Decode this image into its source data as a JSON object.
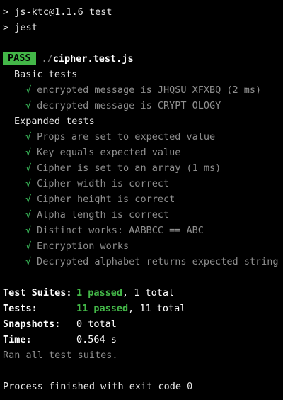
{
  "prompt": {
    "symbol": ">",
    "commands": [
      "js-ktc@1.1.6 test",
      "jest"
    ]
  },
  "result": {
    "badge": "PASS",
    "path_dir": "./",
    "path_file": "cipher.test.js"
  },
  "suites": [
    {
      "name": "Basic tests",
      "tests": [
        "encrypted message is JHQSU XFXBQ (2 ms)",
        "decrypted message is CRYPT OLOGY"
      ]
    },
    {
      "name": "Expanded tests",
      "tests": [
        "Props are set to expected value",
        "Key equals expected value",
        "Cipher is set to an array (1 ms)",
        "Cipher width is correct",
        "Cipher height is correct",
        "Alpha length is correct",
        "Distinct works: AABBCC == ABC",
        "Encryption works",
        "Decrypted alphabet returns expected string"
      ]
    }
  ],
  "check_mark": "√",
  "summary": {
    "suites_label": "Test Suites:",
    "suites_passed": "1 passed",
    "suites_total": ", 1 total",
    "tests_label": "Tests:",
    "tests_passed": "11 passed",
    "tests_total": ", 11 total",
    "snapshots_label": "Snapshots:",
    "snapshots_value": "0 total",
    "time_label": "Time:",
    "time_value": "0.564 s",
    "ran_all": "Ran all test suites."
  },
  "exit_message": "Process finished with exit code 0",
  "colors": {
    "background": "#000000",
    "pass_badge": "#43b748",
    "check": "#3bbf5c",
    "muted": "#8f8f8f"
  }
}
